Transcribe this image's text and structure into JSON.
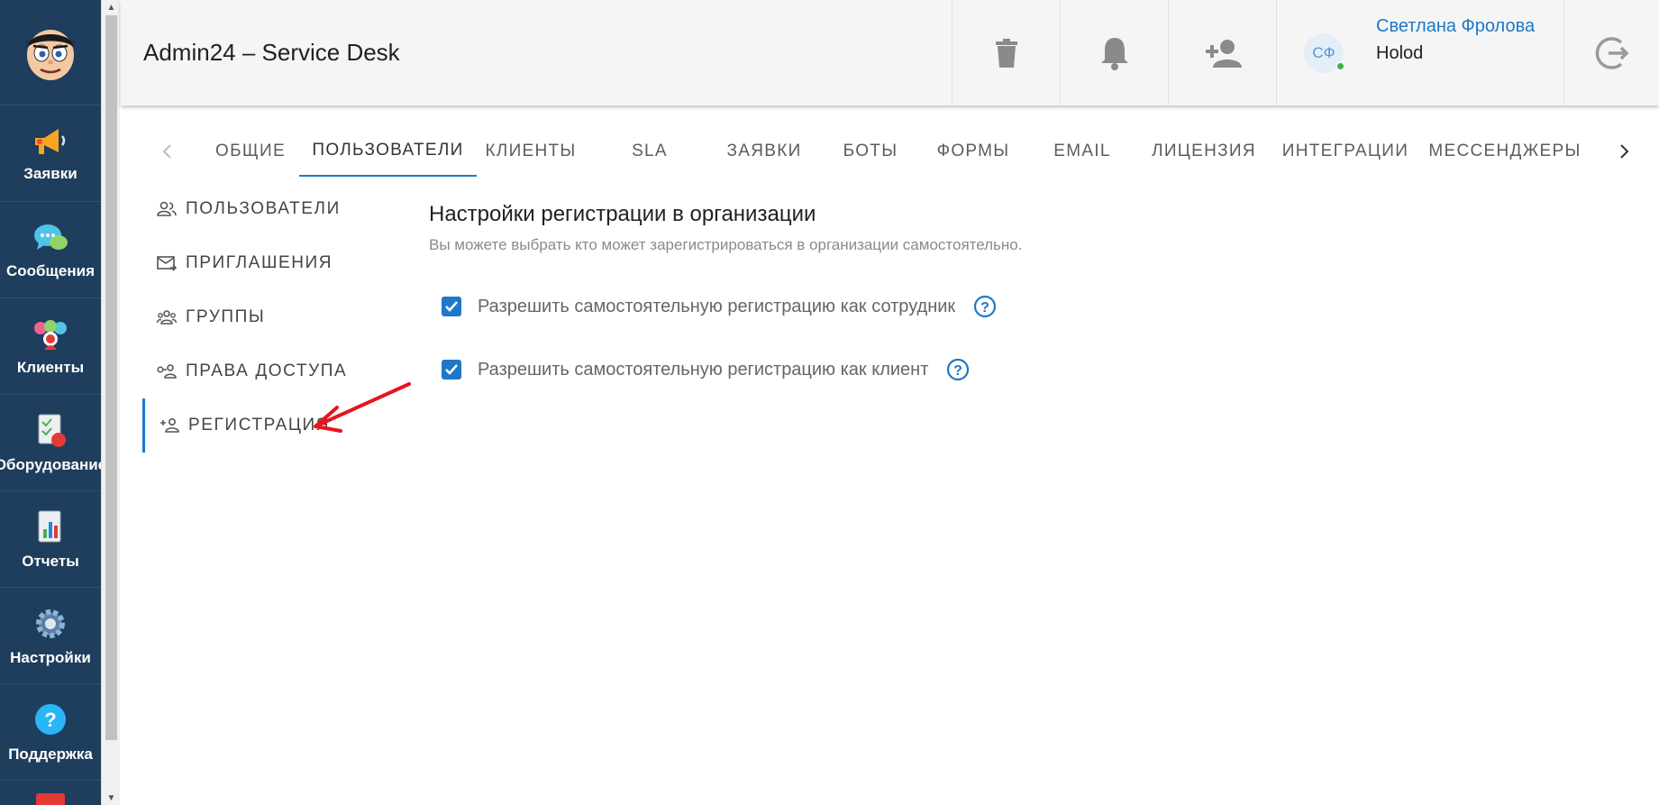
{
  "app": {
    "title": "Admin24 – Service Desk"
  },
  "sidebar": {
    "items": [
      {
        "label": "Заявки",
        "icon": "megaphone-icon"
      },
      {
        "label": "Сообщения",
        "icon": "chat-bubbles-icon"
      },
      {
        "label": "Клиенты",
        "icon": "clients-icon"
      },
      {
        "label": "Оборудование",
        "icon": "equipment-icon"
      },
      {
        "label": "Отчеты",
        "icon": "reports-icon"
      },
      {
        "label": "Настройки",
        "icon": "gear-icon"
      },
      {
        "label": "Поддержка",
        "icon": "help-icon"
      }
    ]
  },
  "header": {
    "user": {
      "initials": "СФ",
      "name": "Светлана Фролова",
      "org": "Holod"
    }
  },
  "tabs": [
    {
      "label": "ОБЩИЕ"
    },
    {
      "label": "ПОЛЬЗОВАТЕЛИ"
    },
    {
      "label": "КЛИЕНТЫ"
    },
    {
      "label": "SLA"
    },
    {
      "label": "ЗАЯВКИ"
    },
    {
      "label": "БОТЫ"
    },
    {
      "label": "ФОРМЫ"
    },
    {
      "label": "EMAIL"
    },
    {
      "label": "ЛИЦЕНЗИЯ"
    },
    {
      "label": "ИНТЕГРАЦИИ"
    },
    {
      "label": "МЕССЕНДЖЕРЫ"
    }
  ],
  "active_tab": "ПОЛЬЗОВАТЕЛИ",
  "subnav": [
    {
      "label": "ПОЛЬЗОВАТЕЛИ",
      "icon": "users-icon"
    },
    {
      "label": "ПРИГЛАШЕНИЯ",
      "icon": "mail-invite-icon"
    },
    {
      "label": "ГРУППЫ",
      "icon": "group-icon"
    },
    {
      "label": "ПРАВА ДОСТУПА",
      "icon": "access-key-icon"
    },
    {
      "label": "РЕГИСТРАЦИЯ",
      "icon": "person-add-icon"
    }
  ],
  "active_subnav": "РЕГИСТРАЦИЯ",
  "content": {
    "title": "Настройки регистрации в организации",
    "description": "Вы можете выбрать кто может зарегистрироваться в организации самостоятельно.",
    "options": [
      {
        "label": "Разрешить самостоятельную регистрацию как сотрудник",
        "checked": true
      },
      {
        "label": "Разрешить самостоятельную регистрацию как клиент",
        "checked": true
      }
    ]
  },
  "colors": {
    "accent": "#1e78c8",
    "sidebar": "#1f3d5c",
    "annotation_arrow": "#e8141c"
  }
}
